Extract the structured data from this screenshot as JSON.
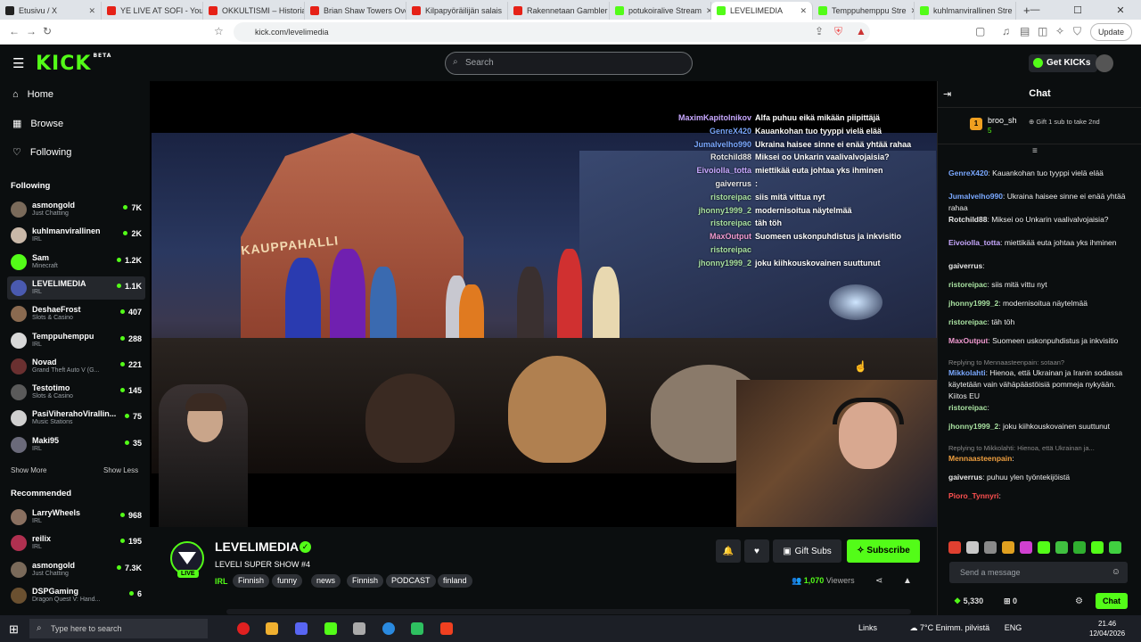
{
  "browser": {
    "tabs": [
      {
        "title": "Etusivu / X",
        "fav": "x"
      },
      {
        "title": "YE LIVE AT SOFI - YouTu",
        "fav": "yt"
      },
      {
        "title": "OKKULTISMI – Historia",
        "fav": "yt"
      },
      {
        "title": "Brian Shaw Towers Over",
        "fav": "yt"
      },
      {
        "title": "Kilpapyöräilijän salais",
        "fav": "yt"
      },
      {
        "title": "Rakennetaan Gambler",
        "fav": "yt"
      },
      {
        "title": "potukoiralive Stream",
        "fav": "k"
      },
      {
        "title": "LEVELIMEDIA",
        "fav": "k",
        "active": true
      },
      {
        "title": "Temppuhemppu Stre",
        "fav": "k"
      },
      {
        "title": "kuhlmanvirallinen Stre",
        "fav": "k"
      }
    ],
    "new_tab": "+",
    "url": "kick.com/levelimedia",
    "update_label": "Update"
  },
  "header": {
    "logo": "KICK",
    "logo_badge": "BETA",
    "search_placeholder": "Search",
    "get_kicks": "Get KICKs"
  },
  "sidebar": {
    "nav": [
      {
        "label": "Home",
        "icon": "home-icon"
      },
      {
        "label": "Browse",
        "icon": "browse-icon"
      },
      {
        "label": "Following",
        "icon": "heart-icon"
      }
    ],
    "following_title": "Following",
    "following": [
      {
        "name": "asmongold",
        "cat": "Just Chatting",
        "viewers": "7K",
        "color": "#7a6a5a"
      },
      {
        "name": "kuhlmanvirallinen",
        "cat": "IRL",
        "viewers": "2K",
        "color": "#c9b8a8"
      },
      {
        "name": "Sam",
        "cat": "Minecraft",
        "viewers": "1.2K",
        "color": "#53fc18"
      },
      {
        "name": "LEVELIMEDIA",
        "cat": "IRL",
        "viewers": "1.1K",
        "color": "#4a5ab0",
        "selected": true
      },
      {
        "name": "DeshaeFrost",
        "cat": "Slots & Casino",
        "viewers": "407",
        "color": "#8a6a50"
      },
      {
        "name": "Temppuhemppu",
        "cat": "IRL",
        "viewers": "288",
        "color": "#d8d8d8"
      },
      {
        "name": "Novad",
        "cat": "Grand Theft Auto V (G...",
        "viewers": "221",
        "color": "#6a3030"
      },
      {
        "name": "Testotimo",
        "cat": "Slots & Casino",
        "viewers": "145",
        "color": "#5a5a5a"
      },
      {
        "name": "PasiViherahoVirallin...",
        "cat": "Music Stations",
        "viewers": "75",
        "color": "#cfcfcf"
      },
      {
        "name": "Maki95",
        "cat": "IRL",
        "viewers": "35",
        "color": "#6a6a7a"
      }
    ],
    "show_more": "Show More",
    "show_less": "Show Less",
    "recommended_title": "Recommended",
    "recommended": [
      {
        "name": "LarryWheels",
        "cat": "IRL",
        "viewers": "968",
        "color": "#8a7060"
      },
      {
        "name": "reilix",
        "cat": "IRL",
        "viewers": "195",
        "color": "#b03050"
      },
      {
        "name": "asmongold",
        "cat": "Just Chatting",
        "viewers": "7.3K",
        "color": "#7a6a5a"
      },
      {
        "name": "DSPGaming",
        "cat": "Dragon Quest V: Hand...",
        "viewers": "6",
        "color": "#6a5030"
      }
    ]
  },
  "video": {
    "hall_sign": "KAUPPAHALLI",
    "overlay_chat": [
      {
        "user": "MaximKapitolnikov",
        "msg": "Alfa puhuu eikä mikään piipittäjä",
        "color": "#c8a8ff"
      },
      {
        "user": "GenreX420",
        "msg": "Kauankohan tuo tyyppi vielä elää",
        "color": "#7aa8ff"
      },
      {
        "user": "Jumalvelho990",
        "msg": "Ukraina haisee sinne ei enää yhtää rahaa",
        "color": "#7aa8ff"
      },
      {
        "user": "Rotchild88",
        "msg": "Miksei oo Unkarin vaalivalvojaisia?",
        "color": "#e8e8e8"
      },
      {
        "user": "Eivoiolla_totta",
        "msg": "miettikää euta johtaa yks ihminen",
        "color": "#c8a8ff"
      },
      {
        "user": "gaiverrus",
        "msg": ":",
        "color": "#e8e8e8"
      },
      {
        "user": "ristoreipac",
        "msg": "siis mitä vittua nyt",
        "color": "#a8e0a0"
      },
      {
        "user": "jhonny1999_2",
        "msg": "modernisoitua näytelmää",
        "color": "#a8e0a0"
      },
      {
        "user": "ristoreipac",
        "msg": "täh töh",
        "color": "#a8e0a0"
      },
      {
        "user": "MaxOutput",
        "msg": "Suomeen uskonpuhdistus ja inkvisitio",
        "color": "#f09ad0"
      },
      {
        "user": "ristoreipac",
        "msg": "",
        "color": "#a8e0a0"
      },
      {
        "user": "jhonny1999_2",
        "msg": "joku kiihkouskovainen suuttunut",
        "color": "#a8e0a0"
      }
    ]
  },
  "stream": {
    "name": "LEVELIMEDIA",
    "live": "LIVE",
    "title": "LEVELI SUPER SHOW #4",
    "category": "IRL",
    "tags": [
      "Finnish",
      "funny",
      "news",
      "Finnish",
      "PODCAST",
      "finland"
    ],
    "gift_subs": "Gift Subs",
    "subscribe": "Subscribe",
    "viewers_count": "1,070",
    "viewers_label": "Viewers"
  },
  "chat": {
    "title": "Chat",
    "pinned_user": "broo_sh",
    "pinned_count": "5",
    "pinned_text": "Gift 1 sub to take 2nd",
    "messages": [
      {
        "user": "GenreX420",
        "text": "Kauankohan tuo tyyppi vielä elää",
        "color": "#7aa8ff"
      },
      {
        "user": "Jumalvelho990",
        "text": "Ukraina haisee sinne ei enää yhtää rahaa",
        "color": "#7aa8ff"
      },
      {
        "user": "Rotchild88",
        "text": "Miksei oo Unkarin vaalivalvojaisia?",
        "color": "#e8e8e8"
      },
      {
        "user": "Eivoiolla_totta",
        "text": "miettikää euta johtaa yks ihminen",
        "color": "#c8a8ff"
      },
      {
        "user": "gaiverrus",
        "text": "",
        "color": "#e8e8e8"
      },
      {
        "user": "ristoreipac",
        "text": "siis mitä vittu nyt",
        "color": "#a8e0a0"
      },
      {
        "user": "jhonny1999_2",
        "text": "modernisoitua näytelmää",
        "color": "#a8e0a0"
      },
      {
        "user": "ristoreipac",
        "text": "täh töh",
        "color": "#a8e0a0"
      },
      {
        "user": "MaxOutput",
        "text": "Suomeen uskonpuhdistus ja inkvisitio",
        "color": "#f09ad0"
      },
      {
        "reply": "Replying to Mennaasteenpain: sotaan?",
        "user": "Mikkolahti",
        "text": "Hienoa, että Ukrainan ja Iranin sodassa käytetään vain vähäpäästöisiä pommeja nykyään. Kiitos EU",
        "color": "#7aa8ff"
      },
      {
        "user": "ristoreipac",
        "text": "",
        "color": "#a8e0a0"
      },
      {
        "user": "jhonny1999_2",
        "text": "joku kiihkouskovainen suuttunut",
        "color": "#a8e0a0"
      },
      {
        "reply": "Replying to Mikkolahti: Hienoa, että Ukrainan ja...",
        "user": "Mennaasteenpain",
        "text": "",
        "color": "#f0a040"
      },
      {
        "user": "gaiverrus",
        "text": "puhuu ylen työntekijöistä",
        "color": "#e8e8e8"
      },
      {
        "user": "Pioro_Tynnyri",
        "text": "",
        "color": "#ff5050"
      }
    ],
    "send_placeholder": "Send a message",
    "kicks_balance": "5,330",
    "points": "0",
    "chat_button": "Chat"
  },
  "taskbar": {
    "search": "Type here to search",
    "links": "Links",
    "weather": "7°C Enimm. pilvistä",
    "lang": "ENG",
    "time": "21.46",
    "date": "12/04/2026"
  }
}
